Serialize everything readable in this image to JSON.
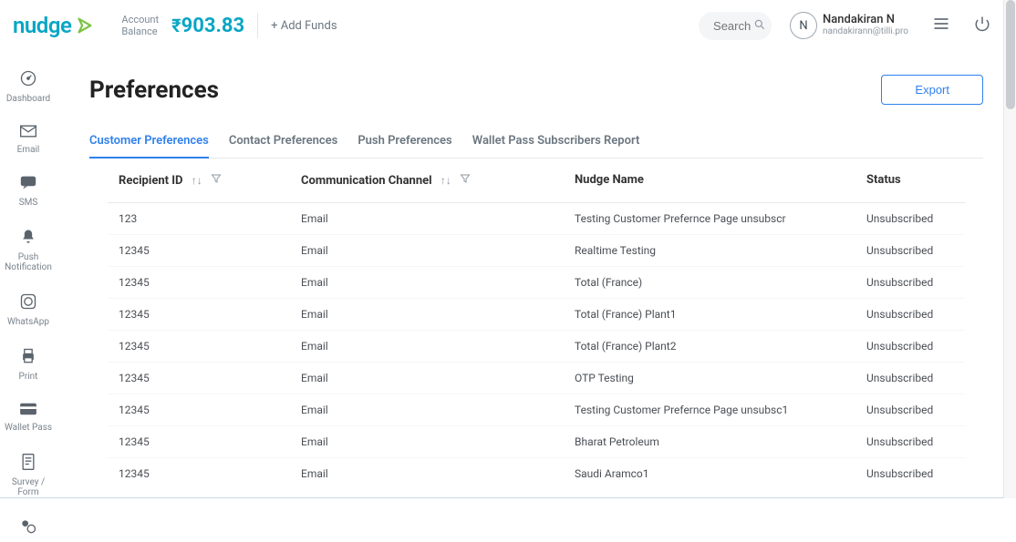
{
  "header": {
    "logo_text": "nudge",
    "account_label_line1": "Account",
    "account_label_line2": "Balance",
    "currency_symbol": "₹",
    "balance_amount": "903.83",
    "add_funds_label": "+ Add Funds",
    "search_placeholder": "Search",
    "user_initial": "N",
    "user_name": "Nandakiran N",
    "user_email": "nandakirann@tilli.pro"
  },
  "sidebar": {
    "items": [
      {
        "label": "Dashboard"
      },
      {
        "label": "Email"
      },
      {
        "label": "SMS"
      },
      {
        "label": "Push Notification"
      },
      {
        "label": "WhatsApp"
      },
      {
        "label": "Print"
      },
      {
        "label": "Wallet Pass"
      },
      {
        "label": "Survey / Form"
      },
      {
        "label": ""
      }
    ]
  },
  "page": {
    "title": "Preferences",
    "export_label": "Export"
  },
  "tabs": [
    {
      "label": "Customer Preferences",
      "active": true
    },
    {
      "label": "Contact Preferences"
    },
    {
      "label": "Push Preferences"
    },
    {
      "label": "Wallet Pass Subscribers Report"
    }
  ],
  "table": {
    "columns": {
      "recipient_id": "Recipient ID",
      "communication_channel": "Communication Channel",
      "nudge_name": "Nudge Name",
      "status": "Status"
    },
    "rows": [
      {
        "id": "123",
        "channel": "Email",
        "nudge": "Testing Customer Prefernce Page unsubscr",
        "status": "Unsubscribed"
      },
      {
        "id": "12345",
        "channel": "Email",
        "nudge": "Realtime Testing",
        "status": "Unsubscribed"
      },
      {
        "id": "12345",
        "channel": "Email",
        "nudge": "Total (France)",
        "status": "Unsubscribed"
      },
      {
        "id": "12345",
        "channel": "Email",
        "nudge": "Total (France) Plant1",
        "status": "Unsubscribed"
      },
      {
        "id": "12345",
        "channel": "Email",
        "nudge": "Total (France) Plant2",
        "status": "Unsubscribed"
      },
      {
        "id": "12345",
        "channel": "Email",
        "nudge": "OTP Testing",
        "status": "Unsubscribed"
      },
      {
        "id": "12345",
        "channel": "Email",
        "nudge": "Testing Customer Prefernce Page unsubsc1",
        "status": "Unsubscribed"
      },
      {
        "id": "12345",
        "channel": "Email",
        "nudge": "Bharat Petroleum",
        "status": "Unsubscribed"
      },
      {
        "id": "12345",
        "channel": "Email",
        "nudge": "Saudi Aramco1",
        "status": "Unsubscribed"
      }
    ]
  }
}
